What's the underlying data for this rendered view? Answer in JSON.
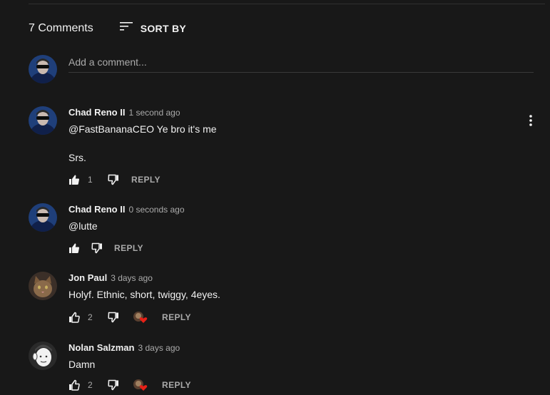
{
  "header": {
    "comment_count_label": "7 Comments",
    "sort_label": "SORT BY",
    "sort_icon": "sort-icon"
  },
  "composer": {
    "placeholder": "Add a comment..."
  },
  "comments": [
    {
      "author": "Chad Reno II",
      "time": "1 second ago",
      "lines": [
        "@FastBananaCEO Ye bro it's me",
        "Srs."
      ],
      "likes": "1",
      "reply_label": "REPLY",
      "creator_heart": false
    },
    {
      "author": "Chad Reno II",
      "time": "0 seconds ago",
      "lines": [
        "@lutte"
      ],
      "likes": "",
      "reply_label": "REPLY",
      "creator_heart": false
    },
    {
      "author": "Jon Paul",
      "time": "3 days ago",
      "lines": [
        "Holyf. Ethnic, short, twiggy, 4eyes."
      ],
      "likes": "2",
      "reply_label": "REPLY",
      "creator_heart": true
    },
    {
      "author": "Nolan Salzman",
      "time": "3 days ago",
      "lines": [
        "Damn"
      ],
      "likes": "2",
      "reply_label": "REPLY",
      "creator_heart": true
    }
  ],
  "colors": {
    "background": "#181818",
    "text": "#f1f1f1",
    "secondary_text": "#aaaaaa",
    "heart": "#e62117"
  }
}
